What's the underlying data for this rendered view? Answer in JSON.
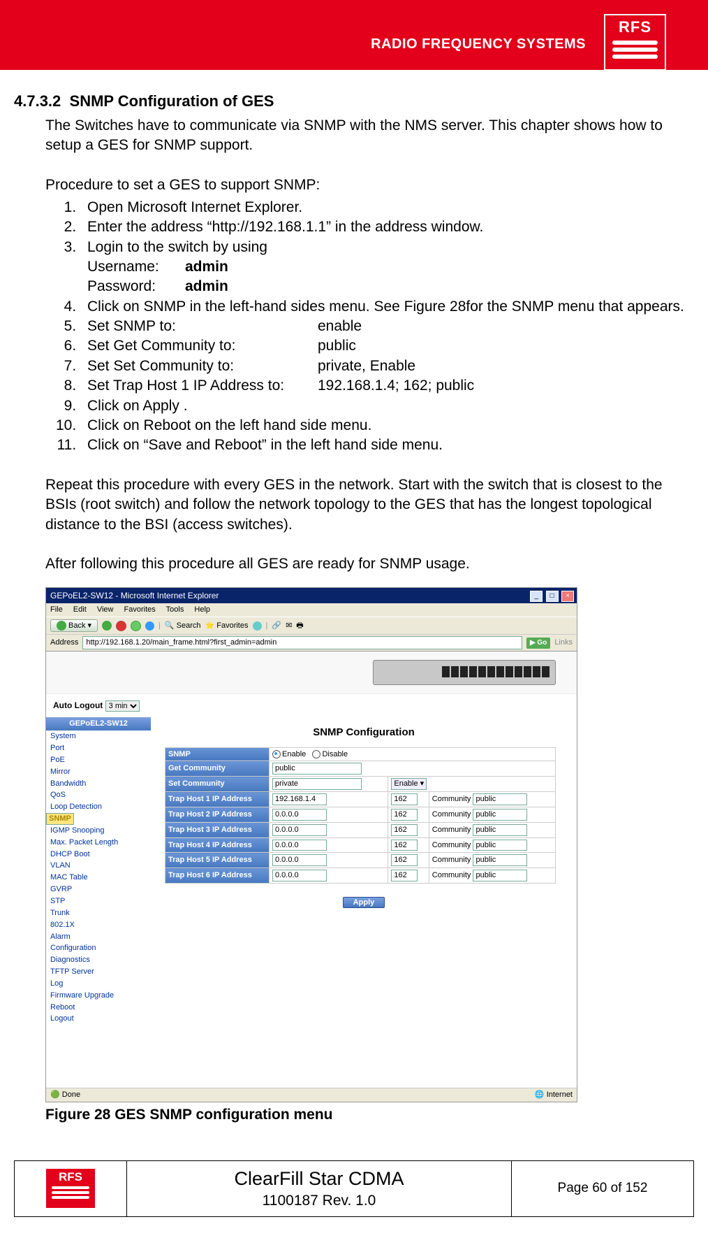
{
  "brand": {
    "banner_text": "RADIO FREQUENCY SYSTEMS",
    "logo_text": "RFS"
  },
  "doc": {
    "heading_num": "4.7.3.2",
    "heading_title": "SNMP Configuration of GES",
    "intro": "The Switches have to communicate via SNMP with the NMS server. This chapter shows how to setup a GES for SNMP support.",
    "proc_intro": "Procedure to set a GES to support SNMP:",
    "steps": {
      "s1": "Open Microsoft Internet Explorer.",
      "s2": "Enter the address “http://192.168.1.1” in the address window.",
      "s3": "Login to the switch by using",
      "s3_user_label": "Username:",
      "s3_user_val": "admin",
      "s3_pass_label": "Password:",
      "s3_pass_val": "admin",
      "s4": "Click on SNMP in the left-hand sides menu. See Figure 28for the SNMP menu that appears.",
      "s5_label": "Set SNMP to:",
      "s5_val": "enable",
      "s6_label": "Set Get Community to:",
      "s6_val": "public",
      "s7_label": "Set Set Community to:",
      "s7_val": "private, Enable",
      "s8_label": "Set Trap Host 1 IP Address to:",
      "s8_val": "192.168.1.4; 162; public",
      "s9": "Click on Apply .",
      "s10": "Click on Reboot on the left hand side menu.",
      "s11": "Click on “Save and Reboot” in the left hand side menu."
    },
    "repeat": "Repeat this procedure with every GES in the network. Start with the switch that is closest to the BSIs (root switch) and follow the network topology to the GES that has the longest topological distance to the BSI (access switches).",
    "after": "After following this procedure all GES are ready for SNMP usage.",
    "fig_caption": "Figure 28 GES SNMP configuration menu"
  },
  "ie": {
    "title": "GEPoEL2-SW12 - Microsoft Internet Explorer",
    "menu": {
      "file": "File",
      "edit": "Edit",
      "view": "View",
      "favorites": "Favorites",
      "tools": "Tools",
      "help": "Help"
    },
    "back": "Back",
    "search": "Search",
    "fav": "Favorites",
    "addr_label": "Address",
    "addr_value": "http://192.168.1.20/main_frame.html?first_admin=admin",
    "go": "Go",
    "links": "Links",
    "status_done": "Done",
    "status_zone": "Internet"
  },
  "switch_ui": {
    "auto_logout_label": "Auto Logout",
    "auto_logout_val": "3 min",
    "side_head": "GEPoEL2-SW12",
    "menu": [
      "System",
      "Port",
      "PoE",
      "Mirror",
      "Bandwidth",
      "QoS",
      "Loop Detection",
      "SNMP",
      "IGMP Snooping",
      "Max. Packet Length",
      "DHCP Boot",
      "VLAN",
      "MAC Table",
      "GVRP",
      "STP",
      "Trunk",
      "802.1X",
      "Alarm",
      "Configuration",
      "Diagnostics",
      "TFTP Server",
      "Log",
      "Firmware Upgrade",
      "Reboot",
      "Logout"
    ],
    "main_title": "SNMP Configuration",
    "rows": {
      "snmp": "SNMP",
      "enable": "Enable",
      "disable": "Disable",
      "get": "Get Community",
      "get_val": "public",
      "set": "Set Community",
      "set_val": "private",
      "set_mode": "Enable",
      "community": "Community",
      "trap1": {
        "label": "Trap Host 1 IP Address",
        "ip": "192.168.1.4",
        "port": "162",
        "com": "public"
      },
      "trap2": {
        "label": "Trap Host 2 IP Address",
        "ip": "0.0.0.0",
        "port": "162",
        "com": "public"
      },
      "trap3": {
        "label": "Trap Host 3 IP Address",
        "ip": "0.0.0.0",
        "port": "162",
        "com": "public"
      },
      "trap4": {
        "label": "Trap Host 4 IP Address",
        "ip": "0.0.0.0",
        "port": "162",
        "com": "public"
      },
      "trap5": {
        "label": "Trap Host 5 IP Address",
        "ip": "0.0.0.0",
        "port": "162",
        "com": "public"
      },
      "trap6": {
        "label": "Trap Host 6 IP Address",
        "ip": "0.0.0.0",
        "port": "162",
        "com": "public"
      }
    },
    "apply": "Apply"
  },
  "footer": {
    "logo": "RFS",
    "title": "ClearFill Star CDMA",
    "rev": "1100187 Rev. 1.0",
    "page": "Page 60 of 152"
  }
}
